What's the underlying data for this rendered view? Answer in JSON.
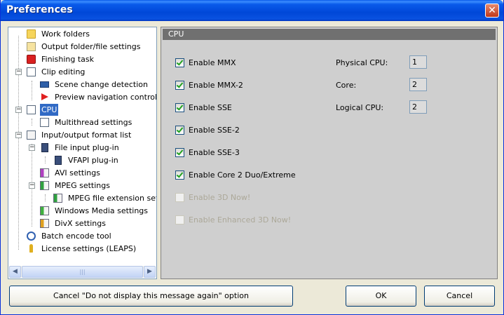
{
  "window": {
    "title": "Preferences",
    "close_glyph": "✕"
  },
  "tree": {
    "items": [
      {
        "label": "Work folders",
        "icon": "folder-icon"
      },
      {
        "label": "Output folder/file settings",
        "icon": "folder-settings-icon"
      },
      {
        "label": "Finishing task",
        "icon": "power-icon"
      },
      {
        "label": "Clip editing",
        "icon": "edit-doc-icon"
      },
      {
        "label": "Scene change detection",
        "icon": "filmstrip-icon"
      },
      {
        "label": "Preview navigation control",
        "icon": "red-arrow-icon"
      },
      {
        "label": "CPU",
        "icon": "edit-doc-icon"
      },
      {
        "label": "Multithread settings",
        "icon": "edit-doc-icon"
      },
      {
        "label": "Input/output format list",
        "icon": "list-doc-icon"
      },
      {
        "label": "File input plug-in",
        "icon": "plugin-icon"
      },
      {
        "label": "VFAPI plug-in",
        "icon": "plugin-icon"
      },
      {
        "label": "AVI settings",
        "icon": "avi-doc-icon"
      },
      {
        "label": "MPEG settings",
        "icon": "mpeg-doc-icon"
      },
      {
        "label": "MPEG file extension settings",
        "icon": "mpeg-doc-icon"
      },
      {
        "label": "Windows Media settings",
        "icon": "wm-doc-icon"
      },
      {
        "label": "DivX settings",
        "icon": "divx-doc-icon"
      },
      {
        "label": "Batch encode tool",
        "icon": "clock-icon"
      },
      {
        "label": "License settings (LEAPS)",
        "icon": "key-icon"
      }
    ],
    "selected": "CPU",
    "expander_minus": "−",
    "scroll_left_glyph": "◀",
    "scroll_right_glyph": "▶",
    "scroll_thumb_grip": "|||"
  },
  "cpu": {
    "header": "CPU",
    "options": [
      {
        "label": "Enable MMX",
        "checked": true,
        "enabled": true
      },
      {
        "label": "Enable MMX-2",
        "checked": true,
        "enabled": true
      },
      {
        "label": "Enable SSE",
        "checked": true,
        "enabled": true
      },
      {
        "label": "Enable SSE-2",
        "checked": true,
        "enabled": true
      },
      {
        "label": "Enable SSE-3",
        "checked": true,
        "enabled": true
      },
      {
        "label": "Enable Core 2 Duo/Extreme",
        "checked": true,
        "enabled": true
      },
      {
        "label": "Enable 3D Now!",
        "checked": false,
        "enabled": false
      },
      {
        "label": "Enable Enhanced 3D Now!",
        "checked": false,
        "enabled": false
      }
    ],
    "physical_cpu_label": "Physical CPU:",
    "physical_cpu_value": "1",
    "core_label": "Core:",
    "core_value": "2",
    "logical_cpu_label": "Logical CPU:",
    "logical_cpu_value": "2"
  },
  "buttons": {
    "cancel_option": "Cancel \"Do not display this message again\" option",
    "ok": "OK",
    "cancel": "Cancel"
  },
  "colors": {
    "title_bar": "#0A5BEA",
    "selection": "#316AC5",
    "check": "#21A121",
    "panel_header": "#707070"
  }
}
